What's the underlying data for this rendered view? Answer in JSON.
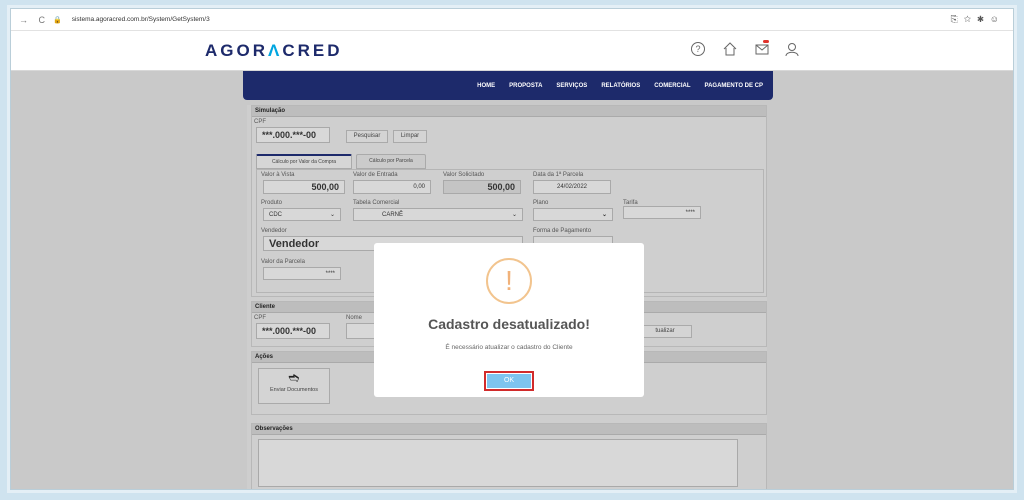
{
  "browser": {
    "nav": "→ C",
    "url": "sistema.agoracred.com.br/System/GetSystem/3"
  },
  "app": {
    "logo_a": "AGOR",
    "logo_l": "Λ",
    "logo_b": "CRED"
  },
  "nav": [
    "HOME",
    "PROPOSTA",
    "SERVIÇOS",
    "RELATÓRIOS",
    "COMERCIAL",
    "PAGAMENTO DE CP"
  ],
  "sim": {
    "title": "Simulação",
    "cpf_label": "CPF",
    "cpf": "***.000.***-00",
    "btn_pesquisar": "Pesquisar",
    "btn_limpar": "Limpar",
    "tab1": "Cálculo por Valor da Compra",
    "tab2": "Cálculo por Parcela",
    "valor_vista_label": "Valor à Vista",
    "valor_vista": "500,00",
    "valor_entrada_label": "Valor de Entrada",
    "valor_entrada": "0,00",
    "valor_solicitado_label": "Valor Solicitado",
    "valor_solicitado": "500,00",
    "data_label": "Data da 1ª Parcela",
    "data": "24/02/2022",
    "produto_label": "Produto",
    "produto": "CDC",
    "tabela_label": "Tabela Comercial",
    "tabela": "CARNÊ",
    "plano_label": "Plano",
    "tarifa_label": "Tarifa",
    "tarifa": "****",
    "vendedor_label": "Vendedor",
    "vendedor": "Vendedor",
    "forma_label": "Forma de Pagamento",
    "parcela_label": "Valor da Parcela",
    "parcela": "****"
  },
  "cliente": {
    "title": "Cliente",
    "cpf_label": "CPF",
    "cpf": "***.000.***-00",
    "nome_label": "Nome",
    "atualizar": "tualizar"
  },
  "acoes": {
    "title": "Ações",
    "enviar": "Enviar Documentos"
  },
  "obs": {
    "title": "Observações"
  },
  "modal": {
    "icon": "!",
    "title": "Cadastro desatualizado!",
    "text": "É necessário atualizar o cadastro do Cliente",
    "ok": "OK"
  },
  "colors": {
    "navy": "#1d2a6b",
    "accent": "#00a6e0",
    "warn": "#f1b27a",
    "ok": "#7ec4ef"
  }
}
